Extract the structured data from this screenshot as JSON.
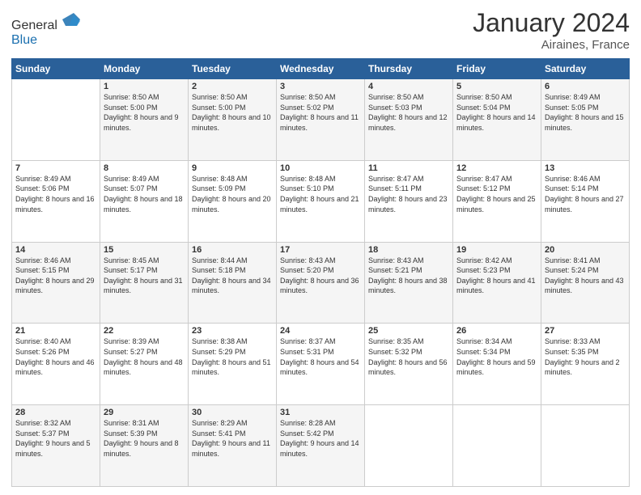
{
  "logo": {
    "general": "General",
    "blue": "Blue"
  },
  "header": {
    "month": "January 2024",
    "location": "Airaines, France"
  },
  "days_of_week": [
    "Sunday",
    "Monday",
    "Tuesday",
    "Wednesday",
    "Thursday",
    "Friday",
    "Saturday"
  ],
  "weeks": [
    [
      {
        "day": "",
        "sunrise": "",
        "sunset": "",
        "daylight": ""
      },
      {
        "day": "1",
        "sunrise": "Sunrise: 8:50 AM",
        "sunset": "Sunset: 5:00 PM",
        "daylight": "Daylight: 8 hours and 9 minutes."
      },
      {
        "day": "2",
        "sunrise": "Sunrise: 8:50 AM",
        "sunset": "Sunset: 5:00 PM",
        "daylight": "Daylight: 8 hours and 10 minutes."
      },
      {
        "day": "3",
        "sunrise": "Sunrise: 8:50 AM",
        "sunset": "Sunset: 5:02 PM",
        "daylight": "Daylight: 8 hours and 11 minutes."
      },
      {
        "day": "4",
        "sunrise": "Sunrise: 8:50 AM",
        "sunset": "Sunset: 5:03 PM",
        "daylight": "Daylight: 8 hours and 12 minutes."
      },
      {
        "day": "5",
        "sunrise": "Sunrise: 8:50 AM",
        "sunset": "Sunset: 5:04 PM",
        "daylight": "Daylight: 8 hours and 14 minutes."
      },
      {
        "day": "6",
        "sunrise": "Sunrise: 8:49 AM",
        "sunset": "Sunset: 5:05 PM",
        "daylight": "Daylight: 8 hours and 15 minutes."
      }
    ],
    [
      {
        "day": "7",
        "sunrise": "Sunrise: 8:49 AM",
        "sunset": "Sunset: 5:06 PM",
        "daylight": "Daylight: 8 hours and 16 minutes."
      },
      {
        "day": "8",
        "sunrise": "Sunrise: 8:49 AM",
        "sunset": "Sunset: 5:07 PM",
        "daylight": "Daylight: 8 hours and 18 minutes."
      },
      {
        "day": "9",
        "sunrise": "Sunrise: 8:48 AM",
        "sunset": "Sunset: 5:09 PM",
        "daylight": "Daylight: 8 hours and 20 minutes."
      },
      {
        "day": "10",
        "sunrise": "Sunrise: 8:48 AM",
        "sunset": "Sunset: 5:10 PM",
        "daylight": "Daylight: 8 hours and 21 minutes."
      },
      {
        "day": "11",
        "sunrise": "Sunrise: 8:47 AM",
        "sunset": "Sunset: 5:11 PM",
        "daylight": "Daylight: 8 hours and 23 minutes."
      },
      {
        "day": "12",
        "sunrise": "Sunrise: 8:47 AM",
        "sunset": "Sunset: 5:12 PM",
        "daylight": "Daylight: 8 hours and 25 minutes."
      },
      {
        "day": "13",
        "sunrise": "Sunrise: 8:46 AM",
        "sunset": "Sunset: 5:14 PM",
        "daylight": "Daylight: 8 hours and 27 minutes."
      }
    ],
    [
      {
        "day": "14",
        "sunrise": "Sunrise: 8:46 AM",
        "sunset": "Sunset: 5:15 PM",
        "daylight": "Daylight: 8 hours and 29 minutes."
      },
      {
        "day": "15",
        "sunrise": "Sunrise: 8:45 AM",
        "sunset": "Sunset: 5:17 PM",
        "daylight": "Daylight: 8 hours and 31 minutes."
      },
      {
        "day": "16",
        "sunrise": "Sunrise: 8:44 AM",
        "sunset": "Sunset: 5:18 PM",
        "daylight": "Daylight: 8 hours and 34 minutes."
      },
      {
        "day": "17",
        "sunrise": "Sunrise: 8:43 AM",
        "sunset": "Sunset: 5:20 PM",
        "daylight": "Daylight: 8 hours and 36 minutes."
      },
      {
        "day": "18",
        "sunrise": "Sunrise: 8:43 AM",
        "sunset": "Sunset: 5:21 PM",
        "daylight": "Daylight: 8 hours and 38 minutes."
      },
      {
        "day": "19",
        "sunrise": "Sunrise: 8:42 AM",
        "sunset": "Sunset: 5:23 PM",
        "daylight": "Daylight: 8 hours and 41 minutes."
      },
      {
        "day": "20",
        "sunrise": "Sunrise: 8:41 AM",
        "sunset": "Sunset: 5:24 PM",
        "daylight": "Daylight: 8 hours and 43 minutes."
      }
    ],
    [
      {
        "day": "21",
        "sunrise": "Sunrise: 8:40 AM",
        "sunset": "Sunset: 5:26 PM",
        "daylight": "Daylight: 8 hours and 46 minutes."
      },
      {
        "day": "22",
        "sunrise": "Sunrise: 8:39 AM",
        "sunset": "Sunset: 5:27 PM",
        "daylight": "Daylight: 8 hours and 48 minutes."
      },
      {
        "day": "23",
        "sunrise": "Sunrise: 8:38 AM",
        "sunset": "Sunset: 5:29 PM",
        "daylight": "Daylight: 8 hours and 51 minutes."
      },
      {
        "day": "24",
        "sunrise": "Sunrise: 8:37 AM",
        "sunset": "Sunset: 5:31 PM",
        "daylight": "Daylight: 8 hours and 54 minutes."
      },
      {
        "day": "25",
        "sunrise": "Sunrise: 8:35 AM",
        "sunset": "Sunset: 5:32 PM",
        "daylight": "Daylight: 8 hours and 56 minutes."
      },
      {
        "day": "26",
        "sunrise": "Sunrise: 8:34 AM",
        "sunset": "Sunset: 5:34 PM",
        "daylight": "Daylight: 8 hours and 59 minutes."
      },
      {
        "day": "27",
        "sunrise": "Sunrise: 8:33 AM",
        "sunset": "Sunset: 5:35 PM",
        "daylight": "Daylight: 9 hours and 2 minutes."
      }
    ],
    [
      {
        "day": "28",
        "sunrise": "Sunrise: 8:32 AM",
        "sunset": "Sunset: 5:37 PM",
        "daylight": "Daylight: 9 hours and 5 minutes."
      },
      {
        "day": "29",
        "sunrise": "Sunrise: 8:31 AM",
        "sunset": "Sunset: 5:39 PM",
        "daylight": "Daylight: 9 hours and 8 minutes."
      },
      {
        "day": "30",
        "sunrise": "Sunrise: 8:29 AM",
        "sunset": "Sunset: 5:41 PM",
        "daylight": "Daylight: 9 hours and 11 minutes."
      },
      {
        "day": "31",
        "sunrise": "Sunrise: 8:28 AM",
        "sunset": "Sunset: 5:42 PM",
        "daylight": "Daylight: 9 hours and 14 minutes."
      },
      {
        "day": "",
        "sunrise": "",
        "sunset": "",
        "daylight": ""
      },
      {
        "day": "",
        "sunrise": "",
        "sunset": "",
        "daylight": ""
      },
      {
        "day": "",
        "sunrise": "",
        "sunset": "",
        "daylight": ""
      }
    ]
  ]
}
